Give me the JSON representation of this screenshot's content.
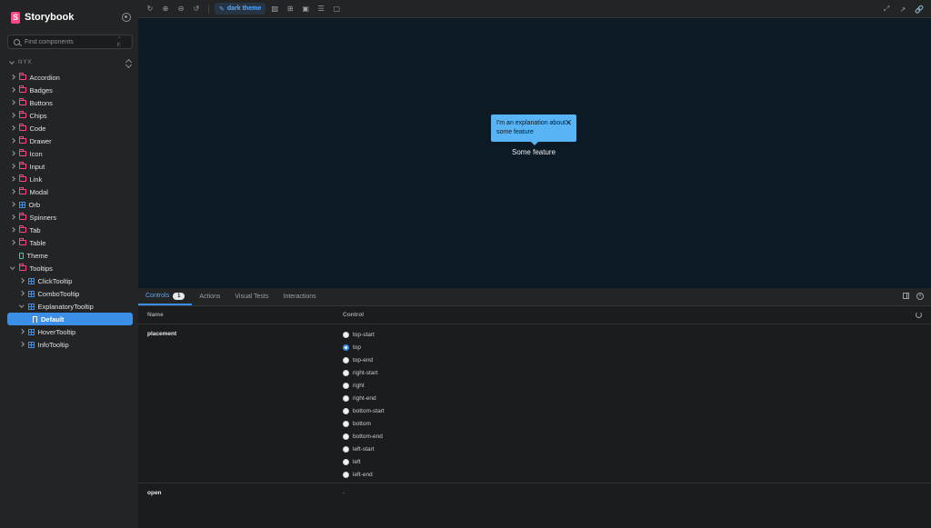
{
  "sidebar": {
    "brand": "Storybook",
    "search_placeholder": "Find components",
    "search_shortcut": "⌃ K",
    "section": "NYX",
    "items": [
      {
        "label": "Accordion",
        "type": "folder"
      },
      {
        "label": "Badges",
        "type": "folder"
      },
      {
        "label": "Buttons",
        "type": "folder"
      },
      {
        "label": "Chips",
        "type": "folder"
      },
      {
        "label": "Code",
        "type": "folder"
      },
      {
        "label": "Drawer",
        "type": "folder"
      },
      {
        "label": "Icon",
        "type": "folder"
      },
      {
        "label": "Input",
        "type": "folder"
      },
      {
        "label": "Link",
        "type": "folder"
      },
      {
        "label": "Modal",
        "type": "folder"
      },
      {
        "label": "Orb",
        "type": "component"
      },
      {
        "label": "Spinners",
        "type": "folder"
      },
      {
        "label": "Tab",
        "type": "folder"
      },
      {
        "label": "Table",
        "type": "folder"
      },
      {
        "label": "Theme",
        "type": "doc"
      },
      {
        "label": "Tooltips",
        "type": "folder"
      },
      {
        "label": "ClickTooltip",
        "type": "component"
      },
      {
        "label": "ComboTooltip",
        "type": "component"
      },
      {
        "label": "ExplanatoryTooltip",
        "type": "component"
      },
      {
        "label": "Default",
        "type": "story"
      },
      {
        "label": "HoverTooltip",
        "type": "component"
      },
      {
        "label": "InfoTooltip",
        "type": "component"
      }
    ]
  },
  "toolbar": {
    "theme_label": "dark theme"
  },
  "canvas": {
    "tooltip_text": "I'm an explanation about some feature",
    "close_glyph": "✕",
    "feature_label": "Some feature"
  },
  "panel": {
    "tabs": [
      {
        "label": "Controls",
        "badge": "1"
      },
      {
        "label": "Actions"
      },
      {
        "label": "Visual Tests"
      },
      {
        "label": "Interactions"
      }
    ],
    "col_name": "Name",
    "col_control": "Control",
    "placement": {
      "name": "placement",
      "selected": "top",
      "options": [
        "top-start",
        "top",
        "top-end",
        "right-start",
        "right",
        "right-end",
        "bottom-start",
        "bottom",
        "bottom-end",
        "left-start",
        "left",
        "left-end"
      ]
    },
    "open": {
      "name": "open",
      "value": "-"
    }
  },
  "colors": {
    "accent": "#3b8fe6",
    "brand": "#ff4785",
    "tooltip": "#58b4f5",
    "canvas_bg": "#0c1a25"
  }
}
